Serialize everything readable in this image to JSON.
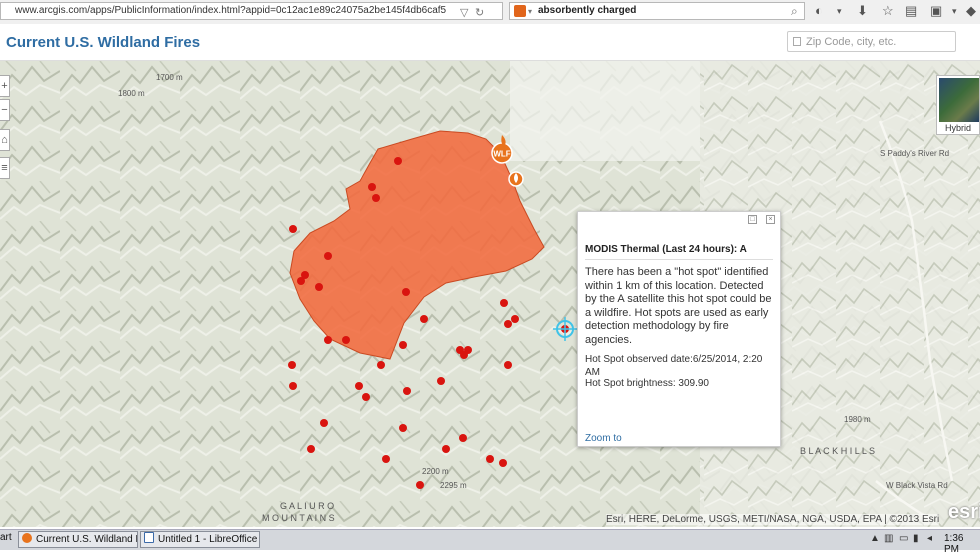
{
  "browser": {
    "url": "www.arcgis.com/apps/PublicInformation/index.html?appid=0c12ac1e89c24075a2be145f4db6caf5",
    "search_query": "absorbently charged"
  },
  "header": {
    "title": "Current U.S. Wildland Fires",
    "search_placeholder": "Zip Code, city, etc."
  },
  "map": {
    "basemap_label": "Hybrid",
    "labels": {
      "mountains_1": "G A L I U R O",
      "mountains_2": "M O U N T A I N S",
      "black_hills": "B L A C K   H I L L S",
      "elev_1": "2200 m",
      "elev_2": "2295 m",
      "elev_3": "1800 m",
      "elev_4": "1700 m",
      "elev_5": "1980 m",
      "road_1": "S Paddy's River Rd",
      "road_2": "W Black Vista Rd"
    },
    "fire_badge": "WLF",
    "attribution": "Esri, HERE, DeLorme, USGS, METI/NASA, NGA, USDA, EPA | ©2013 Esri",
    "logo": "esri"
  },
  "popup": {
    "title": "MODIS Thermal (Last 24 hours): A",
    "body": "There has been a \"hot spot\" identified within 1 km of this location. Detected by the A satellite this hot spot could be a wildfire. Hot spots are used as early detection methodology by fire agencies.",
    "date": "Hot Spot observed date:6/25/2014, 2:20 AM",
    "brightness": "Hot Spot brightness: 309.90",
    "zoom_link": "Zoom to"
  },
  "taskbar": {
    "start": "art",
    "tasks": [
      "Current U.S. Wildland F...",
      "Untitled 1 - LibreOffice ..."
    ],
    "clock": "1:36 PM"
  },
  "colors": {
    "fire_perimeter": "#f26a3d",
    "hot_spot": "#d9140f",
    "title_blue": "#2f6da3"
  }
}
